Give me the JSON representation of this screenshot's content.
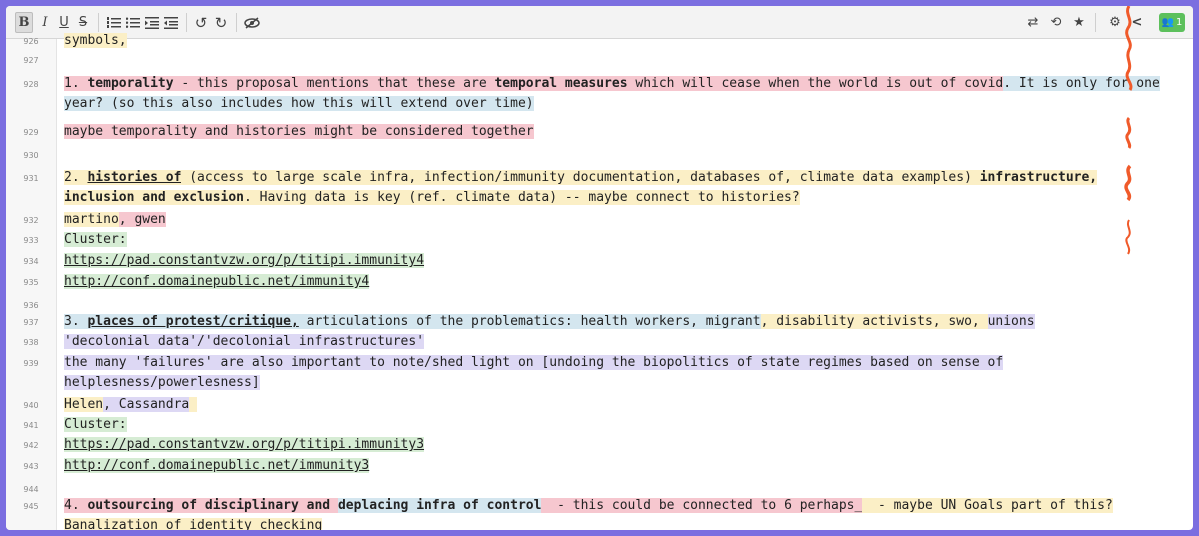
{
  "toolbar": {
    "bold": "B",
    "italic": "I",
    "underline": "U",
    "strike": "S",
    "ol": "☰",
    "ul": "☰",
    "indent": "⇥",
    "outdent": "⇤",
    "undo": "↺",
    "redo": "↻",
    "hide": "⊘",
    "import": "⇄",
    "history": "⟲",
    "star": "★",
    "settings": "⚙",
    "share": "<",
    "users_count": "1"
  },
  "colors": {
    "red": "#f6c7cf",
    "blue": "#d4e6ef",
    "yellow": "#fbefc6",
    "green": "#d6ecd4",
    "purple": "#ddd8f4",
    "frame": "#7b6ee0"
  },
  "lines": {
    "l926": {
      "num": "926",
      "t1": "symbols,"
    },
    "l927": {
      "num": "927"
    },
    "l928": {
      "num": "928",
      "t1": "1. ",
      "t2": "temporality",
      "t3": " - this proposal mentions that these are ",
      "t4": "temporal measures",
      "t5": " which will cease when the world is out of covid",
      "t6": ". It is only for one",
      "t7": "year? (so this also includes how this will extend over time)"
    },
    "l929": {
      "num": "929",
      "t1": "maybe temporality and histories might be considered together"
    },
    "l930": {
      "num": "930"
    },
    "l931": {
      "num": "931",
      "t1": "2. ",
      "t2": "histories of",
      "t3": " (access to large scale infra, infection/immunity documentation, databases of, climate data examples) ",
      "t4": "infrastructure,",
      "t5": "inclusion and exclusion",
      "t6": ". Having data is key (ref. climate data) -- maybe connect to histories?"
    },
    "l932": {
      "num": "932",
      "t1": "martino",
      "t2": ", gwen"
    },
    "l933": {
      "num": "933",
      "t1": "Cluster:"
    },
    "l934": {
      "num": "934",
      "t1": "https://pad.constantvzw.org/p/titipi.immunity4"
    },
    "l935": {
      "num": "935",
      "t1": "http://conf.domainepublic.net/immunity4"
    },
    "l936": {
      "num": "936"
    },
    "l937": {
      "num": "937",
      "t1": "3. ",
      "t2": "places of protest/critique,",
      "t3": " articulations of the problematics: health workers, migrant",
      "t4": ", disability activists, swo, ",
      "t5": "unions"
    },
    "l938": {
      "num": "938",
      "t1": "'decolonial data'/'decolonial infrastructures'"
    },
    "l939": {
      "num": "939",
      "t1": "the many 'failures' are also important to note/shed light on [undoing the biopolitics of state regimes based on sense of",
      "t2": "helplesness/powerlesness]"
    },
    "l940": {
      "num": "940",
      "t1": "Helen",
      "t2": ", Cassandra"
    },
    "l941": {
      "num": "941",
      "t1": "Cluster:"
    },
    "l942": {
      "num": "942",
      "t1": "https://pad.constantvzw.org/p/titipi.immunity3"
    },
    "l943": {
      "num": "943",
      "t1": "http://conf.domainepublic.net/immunity3"
    },
    "l944": {
      "num": "944"
    },
    "l945": {
      "num": "945",
      "t1": "4. ",
      "t2": "outsourcing of disciplinary and ",
      "t3": "deplacing infra of control",
      "t4": "  - this could be connected to 6 perhaps_",
      "t5": "  - maybe UN Goals part of this?",
      "t6": "Banalization of identity checking"
    }
  }
}
